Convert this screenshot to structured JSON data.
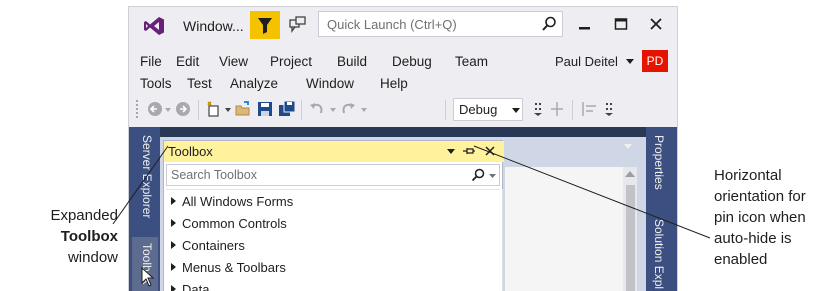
{
  "window": {
    "title": "Window...",
    "quick_launch_placeholder": "Quick Launch (Ctrl+Q)"
  },
  "menu": {
    "row1": [
      "File",
      "Edit",
      "View",
      "Project",
      "Build",
      "Debug",
      "Team"
    ],
    "row2": [
      "Tools",
      "Test",
      "Analyze",
      "Window",
      "Help"
    ],
    "user_name": "Paul Deitel",
    "avatar_initials": "PD"
  },
  "toolbar": {
    "config_value": "Debug"
  },
  "dock": {
    "left_tabs": [
      "Server Explorer",
      "Toolbox"
    ],
    "right_tabs": [
      "Properties",
      "Solution Expl"
    ]
  },
  "toolbox": {
    "title": "Toolbox",
    "search_placeholder": "Search Toolbox",
    "categories": [
      "All Windows Forms",
      "Common Controls",
      "Containers",
      "Menus & Toolbars",
      "Data"
    ]
  },
  "callouts": {
    "left": {
      "line1": "Expanded",
      "line2": "Toolbox",
      "line3": "window"
    },
    "right": [
      "Horizontal",
      "orientation for",
      "pin icon when",
      "auto-hide is",
      "enabled"
    ]
  },
  "colors": {
    "accent_purple": "#68217a",
    "filter_yellow": "#f5c200",
    "avatar_red": "#e51400",
    "dock_blue": "#293955",
    "toolbox_header": "#fff29d"
  }
}
